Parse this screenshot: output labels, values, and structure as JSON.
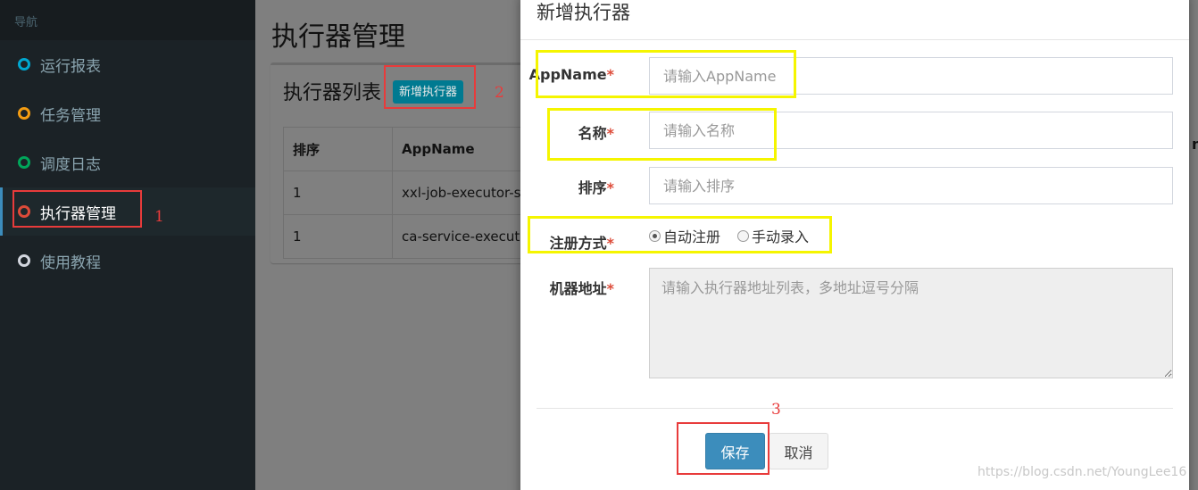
{
  "sidebar": {
    "header": "导航",
    "items": [
      {
        "label": "运行报表",
        "ring_color": "#00a7d0"
      },
      {
        "label": "任务管理",
        "ring_color": "#f39c12"
      },
      {
        "label": "调度日志",
        "ring_color": "#00a65a"
      },
      {
        "label": "执行器管理",
        "ring_color": "#dd4b39"
      },
      {
        "label": "使用教程",
        "ring_color": "#d2d6de"
      }
    ]
  },
  "main": {
    "page_title": "执行器管理",
    "box_title": "执行器列表",
    "add_button": "新增执行器",
    "table": {
      "headers": [
        "排序",
        "AppName"
      ],
      "rows": [
        [
          "1",
          "xxl-job-executor-sa"
        ],
        [
          "1",
          "ca-service-executo"
        ]
      ]
    },
    "clipped_edge_char": "n"
  },
  "modal": {
    "title": "新增执行器",
    "fields": {
      "appname": {
        "label": "AppName",
        "placeholder": "请输入AppName"
      },
      "title": {
        "label": "名称",
        "placeholder": "请输入名称"
      },
      "order": {
        "label": "排序",
        "placeholder": "请输入排序"
      },
      "address_type": {
        "label": "注册方式",
        "options": [
          "自动注册",
          "手动录入"
        ],
        "selected": "自动注册"
      },
      "address_list": {
        "label": "机器地址",
        "placeholder": "请输入执行器地址列表，多地址逗号分隔"
      }
    },
    "required_mark": "*",
    "save": "保存",
    "cancel": "取消"
  },
  "annotations": {
    "step1": "1",
    "step2": "2",
    "step3": "3",
    "highlight_red": "#e83b3b",
    "highlight_yellow": "#f5f500"
  },
  "watermark": "https://blog.csdn.net/YoungLee16"
}
